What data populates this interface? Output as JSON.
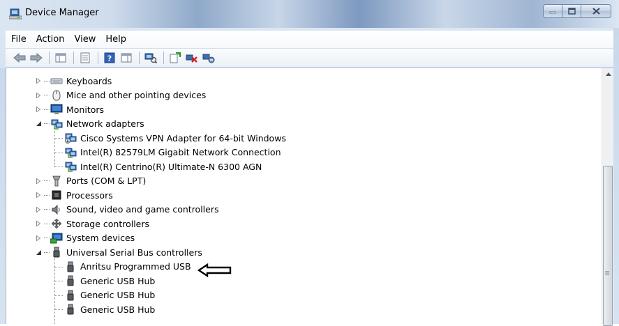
{
  "window": {
    "title": "Device Manager",
    "buttons": {
      "minimize": "minimize",
      "maximize": "maximize",
      "close": "close"
    }
  },
  "menu": [
    "File",
    "Action",
    "View",
    "Help"
  ],
  "toolbar": {
    "icons": [
      "back-arrow-icon",
      "forward-arrow-icon",
      "show-hide-tree-icon",
      "properties-icon",
      "help-icon",
      "action-pane-icon",
      "scan-hardware-icon",
      "update-driver-icon",
      "uninstall-device-icon",
      "disable-device-icon"
    ]
  },
  "tree": {
    "items": [
      {
        "label": "Keyboards",
        "icon": "keyboard-icon",
        "state": "collapsed"
      },
      {
        "label": "Mice and other pointing devices",
        "icon": "mouse-icon",
        "state": "collapsed"
      },
      {
        "label": "Monitors",
        "icon": "monitor-icon",
        "state": "collapsed"
      },
      {
        "label": "Network adapters",
        "icon": "network-icon",
        "state": "expanded"
      },
      {
        "label": "Cisco Systems VPN Adapter for 64-bit Windows",
        "icon": "network-vpn-icon",
        "state": "child"
      },
      {
        "label": "Intel(R) 82579LM Gigabit Network Connection",
        "icon": "network-icon",
        "state": "child"
      },
      {
        "label": "Intel(R) Centrino(R) Ultimate-N 6300 AGN",
        "icon": "network-icon",
        "state": "child"
      },
      {
        "label": "Ports (COM & LPT)",
        "icon": "port-icon",
        "state": "collapsed"
      },
      {
        "label": "Processors",
        "icon": "processor-icon",
        "state": "collapsed"
      },
      {
        "label": "Sound, video and game controllers",
        "icon": "sound-icon",
        "state": "collapsed"
      },
      {
        "label": "Storage controllers",
        "icon": "storage-icon",
        "state": "collapsed"
      },
      {
        "label": "System devices",
        "icon": "system-icon",
        "state": "collapsed"
      },
      {
        "label": "Universal Serial Bus controllers",
        "icon": "usb-icon",
        "state": "expanded"
      },
      {
        "label": "Anritsu Programmed USB",
        "icon": "usb-icon",
        "state": "child"
      },
      {
        "label": "Generic USB Hub",
        "icon": "usb-icon",
        "state": "child"
      },
      {
        "label": "Generic USB Hub",
        "icon": "usb-icon",
        "state": "child"
      },
      {
        "label": "Generic USB Hub",
        "icon": "usb-icon",
        "state": "child"
      }
    ]
  },
  "annotation": {
    "icon": "left-arrow-annotation-icon"
  },
  "colors": {
    "titlebar": "#cfdcec",
    "selection_border": "#7da2ce",
    "tree_line": "#8a8a8a"
  }
}
